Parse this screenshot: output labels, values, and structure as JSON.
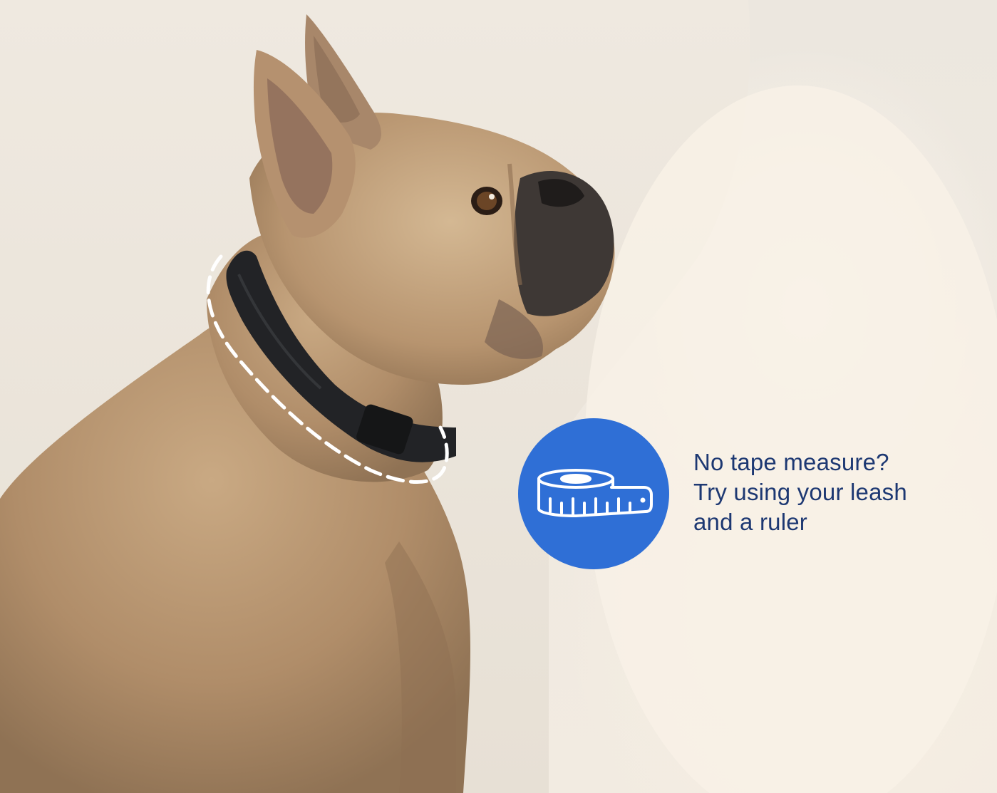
{
  "tip": {
    "lines": [
      "No tape measure?",
      "Try using your leash",
      "and a ruler"
    ]
  },
  "colors": {
    "badge": "#2f6fd6",
    "text": "#1d3872",
    "collar": "#222326"
  },
  "icons": {
    "badge_icon": "tape-measure-icon"
  }
}
